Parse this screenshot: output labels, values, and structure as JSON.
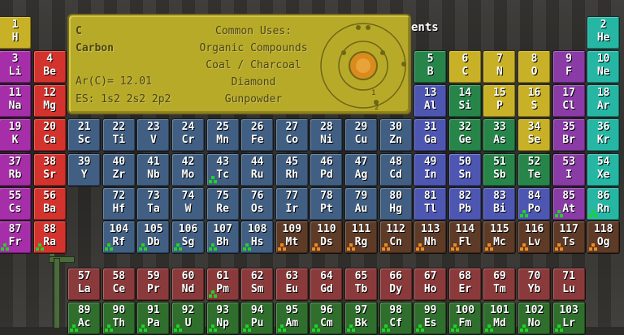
{
  "header": {
    "title_fragment": "ents"
  },
  "tooltip": {
    "symbol": "C",
    "name": "Carbon",
    "atomic_weight": "Ar(C)= 12.01",
    "electron_config": "ES: 1s2 2s2 2p2",
    "uses_title": "Common Uses:",
    "uses": [
      "Organic Compounds",
      "Coal / Charcoal",
      "Diamond",
      "Gunpowder"
    ],
    "shell_labels": [
      "1",
      "2"
    ]
  },
  "colors": {
    "alkali": "#a62ea8",
    "alkaline": "#d4332d",
    "transition": "#415f82",
    "post_transition": "#4d57b2",
    "metalloid": "#27854a",
    "nonmetal": "#c8b126",
    "halogen": "#8a3ba6",
    "noble": "#26b6a4",
    "unknown": "#5d3b26",
    "lanthanide": "#8a3a3a",
    "actinide": "#2f6e2c",
    "tooltip_bg": "#b8aa29"
  },
  "elements": [
    {
      "n": "1",
      "s": "H",
      "cat": "nonmetal"
    },
    {
      "n": "2",
      "s": "He",
      "cat": "noble"
    },
    {
      "n": "3",
      "s": "Li",
      "cat": "alkali"
    },
    {
      "n": "4",
      "s": "Be",
      "cat": "alkaline"
    },
    {
      "n": "5",
      "s": "B",
      "cat": "metalloid"
    },
    {
      "n": "6",
      "s": "C",
      "cat": "nonmetal"
    },
    {
      "n": "7",
      "s": "N",
      "cat": "nonmetal"
    },
    {
      "n": "8",
      "s": "O",
      "cat": "nonmetal"
    },
    {
      "n": "9",
      "s": "F",
      "cat": "halogen"
    },
    {
      "n": "10",
      "s": "Ne",
      "cat": "noble"
    },
    {
      "n": "11",
      "s": "Na",
      "cat": "alkali"
    },
    {
      "n": "12",
      "s": "Mg",
      "cat": "alkaline"
    },
    {
      "n": "13",
      "s": "Al",
      "cat": "post_transition"
    },
    {
      "n": "14",
      "s": "Si",
      "cat": "metalloid"
    },
    {
      "n": "15",
      "s": "P",
      "cat": "nonmetal"
    },
    {
      "n": "16",
      "s": "S",
      "cat": "nonmetal"
    },
    {
      "n": "17",
      "s": "Cl",
      "cat": "halogen"
    },
    {
      "n": "18",
      "s": "Ar",
      "cat": "noble"
    },
    {
      "n": "19",
      "s": "K",
      "cat": "alkali"
    },
    {
      "n": "20",
      "s": "Ca",
      "cat": "alkaline"
    },
    {
      "n": "21",
      "s": "Sc",
      "cat": "transition"
    },
    {
      "n": "22",
      "s": "Ti",
      "cat": "transition"
    },
    {
      "n": "23",
      "s": "V",
      "cat": "transition"
    },
    {
      "n": "24",
      "s": "Cr",
      "cat": "transition"
    },
    {
      "n": "25",
      "s": "Mn",
      "cat": "transition"
    },
    {
      "n": "26",
      "s": "Fe",
      "cat": "transition"
    },
    {
      "n": "27",
      "s": "Co",
      "cat": "transition"
    },
    {
      "n": "28",
      "s": "Ni",
      "cat": "transition"
    },
    {
      "n": "29",
      "s": "Cu",
      "cat": "transition"
    },
    {
      "n": "30",
      "s": "Zn",
      "cat": "transition"
    },
    {
      "n": "31",
      "s": "Ga",
      "cat": "post_transition"
    },
    {
      "n": "32",
      "s": "Ge",
      "cat": "metalloid"
    },
    {
      "n": "33",
      "s": "As",
      "cat": "metalloid"
    },
    {
      "n": "34",
      "s": "Se",
      "cat": "nonmetal"
    },
    {
      "n": "35",
      "s": "Br",
      "cat": "halogen"
    },
    {
      "n": "36",
      "s": "Kr",
      "cat": "noble"
    },
    {
      "n": "37",
      "s": "Rb",
      "cat": "alkali"
    },
    {
      "n": "38",
      "s": "Sr",
      "cat": "alkaline"
    },
    {
      "n": "39",
      "s": "Y",
      "cat": "transition"
    },
    {
      "n": "40",
      "s": "Zr",
      "cat": "transition"
    },
    {
      "n": "41",
      "s": "Nb",
      "cat": "transition"
    },
    {
      "n": "42",
      "s": "Mo",
      "cat": "transition"
    },
    {
      "n": "43",
      "s": "Tc",
      "cat": "transition",
      "rad": true
    },
    {
      "n": "44",
      "s": "Ru",
      "cat": "transition"
    },
    {
      "n": "45",
      "s": "Rh",
      "cat": "transition"
    },
    {
      "n": "46",
      "s": "Pd",
      "cat": "transition"
    },
    {
      "n": "47",
      "s": "Ag",
      "cat": "transition"
    },
    {
      "n": "48",
      "s": "Cd",
      "cat": "transition"
    },
    {
      "n": "49",
      "s": "In",
      "cat": "post_transition"
    },
    {
      "n": "50",
      "s": "Sn",
      "cat": "post_transition"
    },
    {
      "n": "51",
      "s": "Sb",
      "cat": "metalloid"
    },
    {
      "n": "52",
      "s": "Te",
      "cat": "metalloid"
    },
    {
      "n": "53",
      "s": "I",
      "cat": "halogen"
    },
    {
      "n": "54",
      "s": "Xe",
      "cat": "noble"
    },
    {
      "n": "55",
      "s": "Cs",
      "cat": "alkali"
    },
    {
      "n": "56",
      "s": "Ba",
      "cat": "alkaline"
    },
    {
      "n": "72",
      "s": "Hf",
      "cat": "transition"
    },
    {
      "n": "73",
      "s": "Ta",
      "cat": "transition"
    },
    {
      "n": "74",
      "s": "W",
      "cat": "transition"
    },
    {
      "n": "75",
      "s": "Re",
      "cat": "transition"
    },
    {
      "n": "76",
      "s": "Os",
      "cat": "transition"
    },
    {
      "n": "77",
      "s": "Ir",
      "cat": "transition"
    },
    {
      "n": "78",
      "s": "Pt",
      "cat": "transition"
    },
    {
      "n": "79",
      "s": "Au",
      "cat": "transition"
    },
    {
      "n": "80",
      "s": "Hg",
      "cat": "transition"
    },
    {
      "n": "81",
      "s": "Tl",
      "cat": "post_transition"
    },
    {
      "n": "82",
      "s": "Pb",
      "cat": "post_transition"
    },
    {
      "n": "83",
      "s": "Bi",
      "cat": "post_transition"
    },
    {
      "n": "84",
      "s": "Po",
      "cat": "post_transition",
      "rad": true
    },
    {
      "n": "85",
      "s": "At",
      "cat": "halogen",
      "rad": true
    },
    {
      "n": "86",
      "s": "Rn",
      "cat": "noble",
      "rad": true
    },
    {
      "n": "87",
      "s": "Fr",
      "cat": "alkali",
      "rad": true
    },
    {
      "n": "88",
      "s": "Ra",
      "cat": "alkaline",
      "rad": true
    },
    {
      "n": "104",
      "s": "Rf",
      "cat": "transition",
      "rad": true
    },
    {
      "n": "105",
      "s": "Db",
      "cat": "transition",
      "rad": true
    },
    {
      "n": "106",
      "s": "Sg",
      "cat": "transition",
      "rad": true
    },
    {
      "n": "107",
      "s": "Bh",
      "cat": "transition",
      "rad": true
    },
    {
      "n": "108",
      "s": "Hs",
      "cat": "transition",
      "rad": true
    },
    {
      "n": "109",
      "s": "Mt",
      "cat": "unknown",
      "rad": true
    },
    {
      "n": "110",
      "s": "Ds",
      "cat": "unknown",
      "rad": true
    },
    {
      "n": "111",
      "s": "Rg",
      "cat": "unknown",
      "rad": true
    },
    {
      "n": "112",
      "s": "Cn",
      "cat": "unknown",
      "rad": true
    },
    {
      "n": "113",
      "s": "Nh",
      "cat": "unknown",
      "rad": true
    },
    {
      "n": "114",
      "s": "Fl",
      "cat": "unknown",
      "rad": true
    },
    {
      "n": "115",
      "s": "Mc",
      "cat": "unknown",
      "rad": true
    },
    {
      "n": "116",
      "s": "Lv",
      "cat": "unknown",
      "rad": true
    },
    {
      "n": "117",
      "s": "Ts",
      "cat": "unknown",
      "rad": true
    },
    {
      "n": "118",
      "s": "Og",
      "cat": "unknown",
      "rad": true
    },
    {
      "n": "57",
      "s": "La",
      "cat": "lanthanide"
    },
    {
      "n": "58",
      "s": "Ce",
      "cat": "lanthanide"
    },
    {
      "n": "59",
      "s": "Pr",
      "cat": "lanthanide"
    },
    {
      "n": "60",
      "s": "Nd",
      "cat": "lanthanide"
    },
    {
      "n": "61",
      "s": "Pm",
      "cat": "lanthanide",
      "rad": true
    },
    {
      "n": "62",
      "s": "Sm",
      "cat": "lanthanide"
    },
    {
      "n": "63",
      "s": "Eu",
      "cat": "lanthanide"
    },
    {
      "n": "64",
      "s": "Gd",
      "cat": "lanthanide"
    },
    {
      "n": "65",
      "s": "Tb",
      "cat": "lanthanide"
    },
    {
      "n": "66",
      "s": "Dy",
      "cat": "lanthanide"
    },
    {
      "n": "67",
      "s": "Ho",
      "cat": "lanthanide"
    },
    {
      "n": "68",
      "s": "Er",
      "cat": "lanthanide"
    },
    {
      "n": "69",
      "s": "Tm",
      "cat": "lanthanide"
    },
    {
      "n": "70",
      "s": "Yb",
      "cat": "lanthanide"
    },
    {
      "n": "71",
      "s": "Lu",
      "cat": "lanthanide"
    },
    {
      "n": "89",
      "s": "Ac",
      "cat": "actinide",
      "rad": true
    },
    {
      "n": "90",
      "s": "Th",
      "cat": "actinide",
      "rad": true
    },
    {
      "n": "91",
      "s": "Pa",
      "cat": "actinide",
      "rad": true
    },
    {
      "n": "92",
      "s": "U",
      "cat": "actinide",
      "rad": true
    },
    {
      "n": "93",
      "s": "Np",
      "cat": "actinide",
      "rad": true
    },
    {
      "n": "94",
      "s": "Pu",
      "cat": "actinide",
      "rad": true
    },
    {
      "n": "95",
      "s": "Am",
      "cat": "actinide",
      "rad": true
    },
    {
      "n": "96",
      "s": "Cm",
      "cat": "actinide",
      "rad": true
    },
    {
      "n": "97",
      "s": "Bk",
      "cat": "actinide",
      "rad": true
    },
    {
      "n": "98",
      "s": "Cf",
      "cat": "actinide",
      "rad": true
    },
    {
      "n": "99",
      "s": "Es",
      "cat": "actinide",
      "rad": true
    },
    {
      "n": "100",
      "s": "Fm",
      "cat": "actinide",
      "rad": true
    },
    {
      "n": "101",
      "s": "Md",
      "cat": "actinide",
      "rad": true
    },
    {
      "n": "102",
      "s": "No",
      "cat": "actinide",
      "rad": true
    },
    {
      "n": "103",
      "s": "Lr",
      "cat": "actinide",
      "rad": true
    }
  ]
}
